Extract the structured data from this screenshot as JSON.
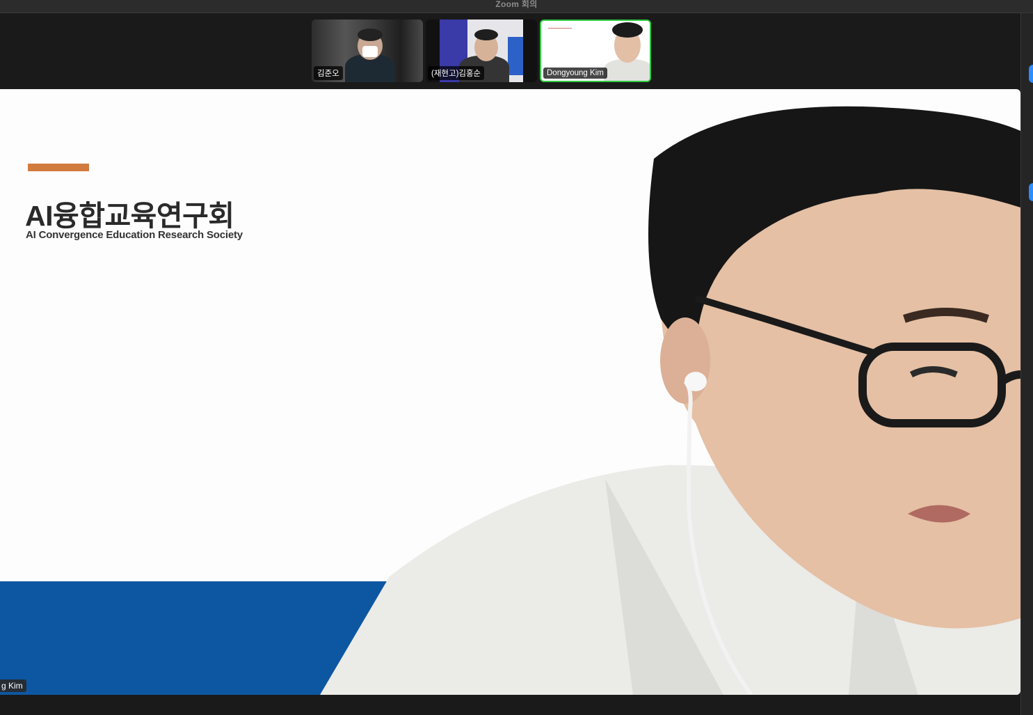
{
  "window": {
    "title": "Zoom 회의"
  },
  "participants": [
    {
      "name": "김준오"
    },
    {
      "name": "(재현고)김홍순"
    },
    {
      "name": "Dongyoung Kim"
    }
  ],
  "slide": {
    "title": "AI융합교육연구회",
    "subtitle": "AI Convergence Education Research Society"
  },
  "main_video": {
    "name_label": "g Kim"
  },
  "colors": {
    "accent": "#d17b3e",
    "band": "#0d57a2",
    "active_border": "#2ecc40"
  }
}
